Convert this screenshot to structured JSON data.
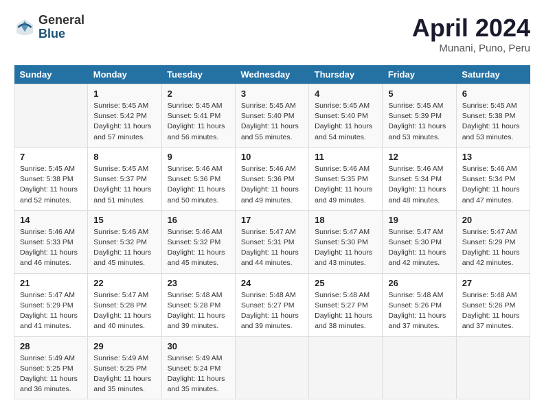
{
  "header": {
    "logo_general": "General",
    "logo_blue": "Blue",
    "month_year": "April 2024",
    "location": "Munani, Puno, Peru"
  },
  "calendar": {
    "columns": [
      "Sunday",
      "Monday",
      "Tuesday",
      "Wednesday",
      "Thursday",
      "Friday",
      "Saturday"
    ],
    "rows": [
      [
        {
          "day": "",
          "info": ""
        },
        {
          "day": "1",
          "info": "Sunrise: 5:45 AM\nSunset: 5:42 PM\nDaylight: 11 hours\nand 57 minutes."
        },
        {
          "day": "2",
          "info": "Sunrise: 5:45 AM\nSunset: 5:41 PM\nDaylight: 11 hours\nand 56 minutes."
        },
        {
          "day": "3",
          "info": "Sunrise: 5:45 AM\nSunset: 5:40 PM\nDaylight: 11 hours\nand 55 minutes."
        },
        {
          "day": "4",
          "info": "Sunrise: 5:45 AM\nSunset: 5:40 PM\nDaylight: 11 hours\nand 54 minutes."
        },
        {
          "day": "5",
          "info": "Sunrise: 5:45 AM\nSunset: 5:39 PM\nDaylight: 11 hours\nand 53 minutes."
        },
        {
          "day": "6",
          "info": "Sunrise: 5:45 AM\nSunset: 5:38 PM\nDaylight: 11 hours\nand 53 minutes."
        }
      ],
      [
        {
          "day": "7",
          "info": "Sunrise: 5:45 AM\nSunset: 5:38 PM\nDaylight: 11 hours\nand 52 minutes."
        },
        {
          "day": "8",
          "info": "Sunrise: 5:45 AM\nSunset: 5:37 PM\nDaylight: 11 hours\nand 51 minutes."
        },
        {
          "day": "9",
          "info": "Sunrise: 5:46 AM\nSunset: 5:36 PM\nDaylight: 11 hours\nand 50 minutes."
        },
        {
          "day": "10",
          "info": "Sunrise: 5:46 AM\nSunset: 5:36 PM\nDaylight: 11 hours\nand 49 minutes."
        },
        {
          "day": "11",
          "info": "Sunrise: 5:46 AM\nSunset: 5:35 PM\nDaylight: 11 hours\nand 49 minutes."
        },
        {
          "day": "12",
          "info": "Sunrise: 5:46 AM\nSunset: 5:34 PM\nDaylight: 11 hours\nand 48 minutes."
        },
        {
          "day": "13",
          "info": "Sunrise: 5:46 AM\nSunset: 5:34 PM\nDaylight: 11 hours\nand 47 minutes."
        }
      ],
      [
        {
          "day": "14",
          "info": "Sunrise: 5:46 AM\nSunset: 5:33 PM\nDaylight: 11 hours\nand 46 minutes."
        },
        {
          "day": "15",
          "info": "Sunrise: 5:46 AM\nSunset: 5:32 PM\nDaylight: 11 hours\nand 45 minutes."
        },
        {
          "day": "16",
          "info": "Sunrise: 5:46 AM\nSunset: 5:32 PM\nDaylight: 11 hours\nand 45 minutes."
        },
        {
          "day": "17",
          "info": "Sunrise: 5:47 AM\nSunset: 5:31 PM\nDaylight: 11 hours\nand 44 minutes."
        },
        {
          "day": "18",
          "info": "Sunrise: 5:47 AM\nSunset: 5:30 PM\nDaylight: 11 hours\nand 43 minutes."
        },
        {
          "day": "19",
          "info": "Sunrise: 5:47 AM\nSunset: 5:30 PM\nDaylight: 11 hours\nand 42 minutes."
        },
        {
          "day": "20",
          "info": "Sunrise: 5:47 AM\nSunset: 5:29 PM\nDaylight: 11 hours\nand 42 minutes."
        }
      ],
      [
        {
          "day": "21",
          "info": "Sunrise: 5:47 AM\nSunset: 5:29 PM\nDaylight: 11 hours\nand 41 minutes."
        },
        {
          "day": "22",
          "info": "Sunrise: 5:47 AM\nSunset: 5:28 PM\nDaylight: 11 hours\nand 40 minutes."
        },
        {
          "day": "23",
          "info": "Sunrise: 5:48 AM\nSunset: 5:28 PM\nDaylight: 11 hours\nand 39 minutes."
        },
        {
          "day": "24",
          "info": "Sunrise: 5:48 AM\nSunset: 5:27 PM\nDaylight: 11 hours\nand 39 minutes."
        },
        {
          "day": "25",
          "info": "Sunrise: 5:48 AM\nSunset: 5:27 PM\nDaylight: 11 hours\nand 38 minutes."
        },
        {
          "day": "26",
          "info": "Sunrise: 5:48 AM\nSunset: 5:26 PM\nDaylight: 11 hours\nand 37 minutes."
        },
        {
          "day": "27",
          "info": "Sunrise: 5:48 AM\nSunset: 5:26 PM\nDaylight: 11 hours\nand 37 minutes."
        }
      ],
      [
        {
          "day": "28",
          "info": "Sunrise: 5:49 AM\nSunset: 5:25 PM\nDaylight: 11 hours\nand 36 minutes."
        },
        {
          "day": "29",
          "info": "Sunrise: 5:49 AM\nSunset: 5:25 PM\nDaylight: 11 hours\nand 35 minutes."
        },
        {
          "day": "30",
          "info": "Sunrise: 5:49 AM\nSunset: 5:24 PM\nDaylight: 11 hours\nand 35 minutes."
        },
        {
          "day": "",
          "info": ""
        },
        {
          "day": "",
          "info": ""
        },
        {
          "day": "",
          "info": ""
        },
        {
          "day": "",
          "info": ""
        }
      ]
    ]
  }
}
